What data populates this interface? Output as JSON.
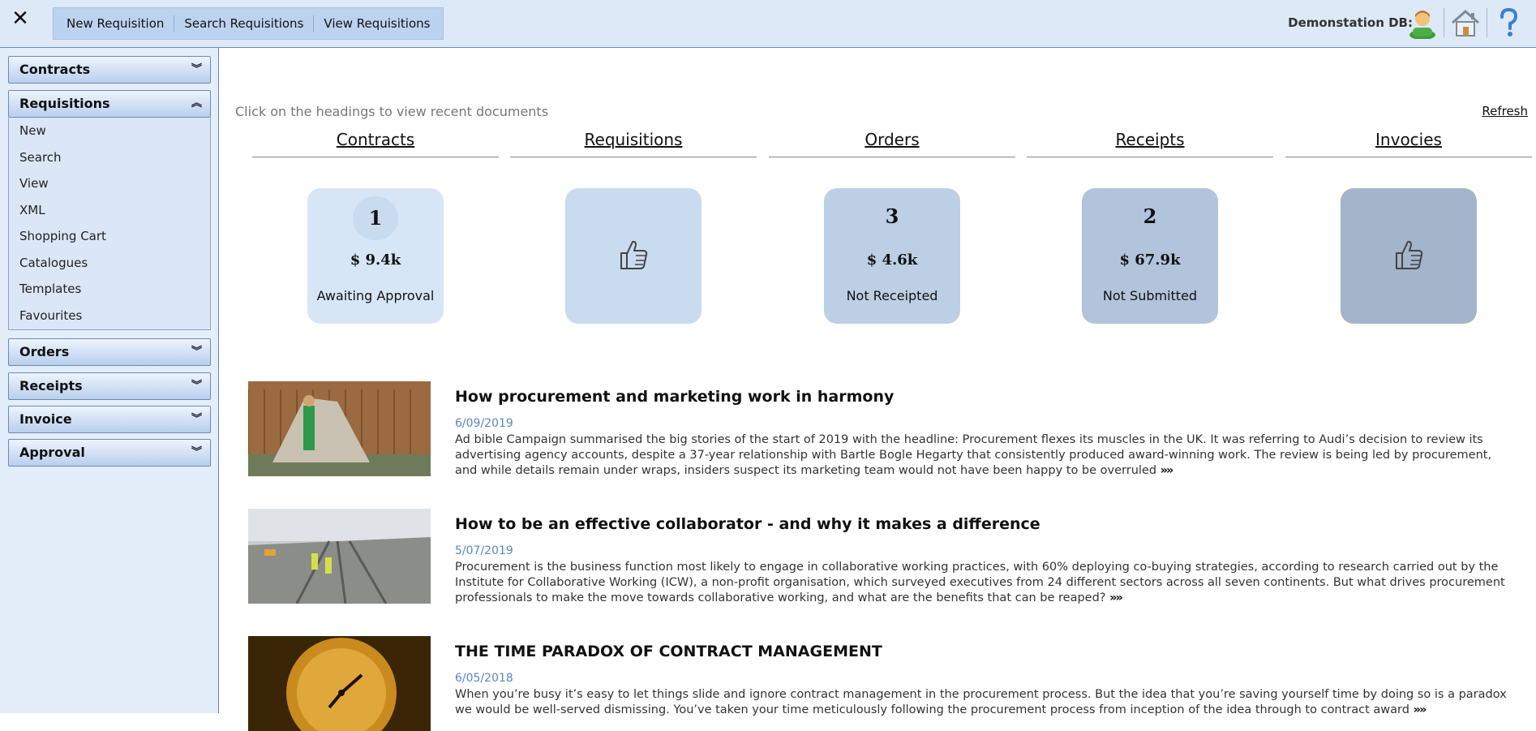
{
  "topbar": {
    "close_glyph": "✕",
    "nav": [
      "New Requisition",
      "Search Requisitions",
      "View Requisitions"
    ],
    "db_label": "Demonstation DB:",
    "icons": [
      "user-icon",
      "home-icon",
      "help-icon"
    ]
  },
  "sidebar": {
    "sections": [
      {
        "label": "Contracts",
        "expanded": false
      },
      {
        "label": "Requisitions",
        "expanded": true,
        "items": [
          "New",
          "Search",
          "View",
          "XML",
          "Shopping Cart",
          "Catalogues",
          "Templates",
          "Favourites"
        ]
      },
      {
        "label": "Orders",
        "expanded": false
      },
      {
        "label": "Receipts",
        "expanded": false
      },
      {
        "label": "Invoice",
        "expanded": false
      },
      {
        "label": "Approval",
        "expanded": false
      }
    ]
  },
  "main": {
    "hint": "Click on the headings to view recent documents",
    "refresh": "Refresh",
    "columns": [
      {
        "heading": "Contracts",
        "count": "1",
        "amount": "$ 9.4k",
        "status": "Awaiting Approval",
        "color": "#d7e6f7"
      },
      {
        "heading": "Requisitions",
        "icon": "thumbs-up-icon",
        "color": "#c9dbee"
      },
      {
        "heading": "Orders",
        "count": "3",
        "amount": "$ 4.6k",
        "status": "Not Receipted",
        "color": "#bccfe4"
      },
      {
        "heading": "Receipts",
        "count": "2",
        "amount": "$ 67.9k",
        "status": "Not Submitted",
        "color": "#b1c4db"
      },
      {
        "heading": "Invocies",
        "icon": "thumbs-up-icon",
        "color": "#a2b5cb"
      }
    ]
  },
  "news": [
    {
      "title": "How procurement and marketing work in harmony",
      "date": "6/09/2019",
      "body": "Ad bible Campaign summarised the big stories of the start of 2019 with the headline: Procurement flexes its muscles in the UK. It was referring to Audi’s decision to review its advertising agency accounts, despite a 37-year relationship with Bartle Bogle Hegarty that consistently produced award-winning work. The review is being led by procurement, and while details remain under wraps, insiders suspect its marketing team would not have been happy to be overruled",
      "more": "»»"
    },
    {
      "title": "How to be an effective collaborator - and why it makes a difference",
      "date": "5/07/2019",
      "body": "Procurement is the business function most likely to engage in collaborative working practices, with 60% deploying co-buying strategies, according to research carried out by the Institute for Collaborative Working (ICW), a non-profit organisation, which surveyed executives from 24 different sectors across all seven continents. But what drives procurement professionals to make the move towards collaborative working, and what are the benefits that can be reaped?",
      "more": "»»"
    },
    {
      "title": "THE TIME PARADOX OF CONTRACT MANAGEMENT",
      "date": "6/05/2018",
      "body": "When you’re busy it’s easy to let things slide and ignore contract management in the procurement process. But the idea that you’re saving yourself time by doing so is a paradox we would be well-served dismissing. You’ve taken your time meticulously following the procurement process from inception of the idea through to contract award",
      "more": "»»"
    }
  ]
}
